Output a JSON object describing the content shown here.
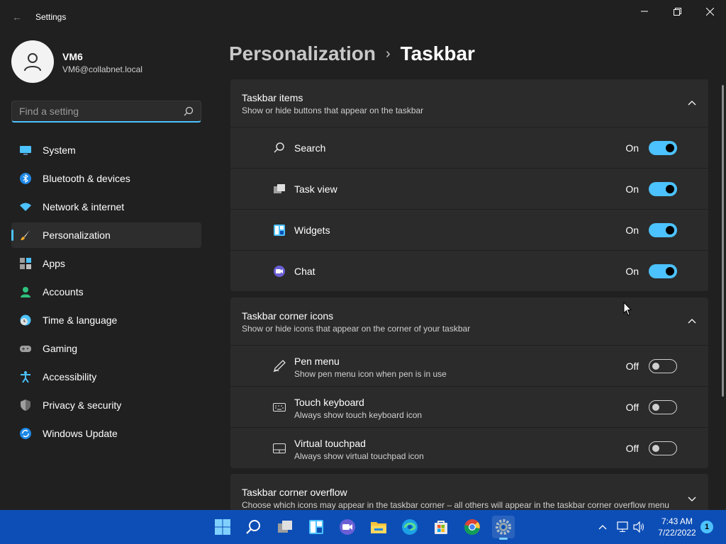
{
  "window": {
    "title": "Settings"
  },
  "profile": {
    "name": "VM6",
    "email": "VM6@collabnet.local"
  },
  "search": {
    "placeholder": "Find a setting"
  },
  "sidebar": {
    "items": [
      {
        "label": "System",
        "icon": "monitor-icon"
      },
      {
        "label": "Bluetooth & devices",
        "icon": "bluetooth-icon"
      },
      {
        "label": "Network & internet",
        "icon": "wifi-icon"
      },
      {
        "label": "Personalization",
        "icon": "brush-icon",
        "selected": true
      },
      {
        "label": "Apps",
        "icon": "apps-icon"
      },
      {
        "label": "Accounts",
        "icon": "person-icon"
      },
      {
        "label": "Time & language",
        "icon": "globe-clock-icon"
      },
      {
        "label": "Gaming",
        "icon": "gamepad-icon"
      },
      {
        "label": "Accessibility",
        "icon": "accessibility-icon"
      },
      {
        "label": "Privacy & security",
        "icon": "shield-icon"
      },
      {
        "label": "Windows Update",
        "icon": "update-icon"
      }
    ]
  },
  "breadcrumb": {
    "parent": "Personalization",
    "separator": "›",
    "current": "Taskbar"
  },
  "sections": {
    "taskbar_items": {
      "title": "Taskbar items",
      "subtitle": "Show or hide buttons that appear on the taskbar",
      "rows": [
        {
          "label": "Search",
          "state": "On",
          "on": true,
          "icon": "search-icon"
        },
        {
          "label": "Task view",
          "state": "On",
          "on": true,
          "icon": "task-view-icon"
        },
        {
          "label": "Widgets",
          "state": "On",
          "on": true,
          "icon": "widgets-icon"
        },
        {
          "label": "Chat",
          "state": "On",
          "on": true,
          "icon": "chat-icon"
        }
      ]
    },
    "corner_icons": {
      "title": "Taskbar corner icons",
      "subtitle": "Show or hide icons that appear on the corner of your taskbar",
      "rows": [
        {
          "label": "Pen menu",
          "sub": "Show pen menu icon when pen is in use",
          "state": "Off",
          "on": false,
          "icon": "pen-icon"
        },
        {
          "label": "Touch keyboard",
          "sub": "Always show touch keyboard icon",
          "state": "Off",
          "on": false,
          "icon": "keyboard-icon"
        },
        {
          "label": "Virtual touchpad",
          "sub": "Always show virtual touchpad icon",
          "state": "Off",
          "on": false,
          "icon": "touchpad-icon"
        }
      ]
    },
    "corner_overflow": {
      "title": "Taskbar corner overflow",
      "subtitle": "Choose which icons may appear in the taskbar corner – all others will appear in the taskbar corner overflow menu"
    }
  },
  "taskbar": {
    "apps": [
      "start-icon",
      "search-icon",
      "task-view-icon",
      "widgets-icon",
      "chat-icon",
      "file-explorer-icon",
      "edge-icon",
      "store-icon",
      "chrome-icon",
      "settings-icon"
    ],
    "time": "7:43 AM",
    "date": "7/22/2022",
    "notifications": "1"
  },
  "colors": {
    "accent": "#4cc2ff",
    "background": "#202020",
    "card": "#2b2b2b",
    "taskbar": "#0d4eb6"
  }
}
